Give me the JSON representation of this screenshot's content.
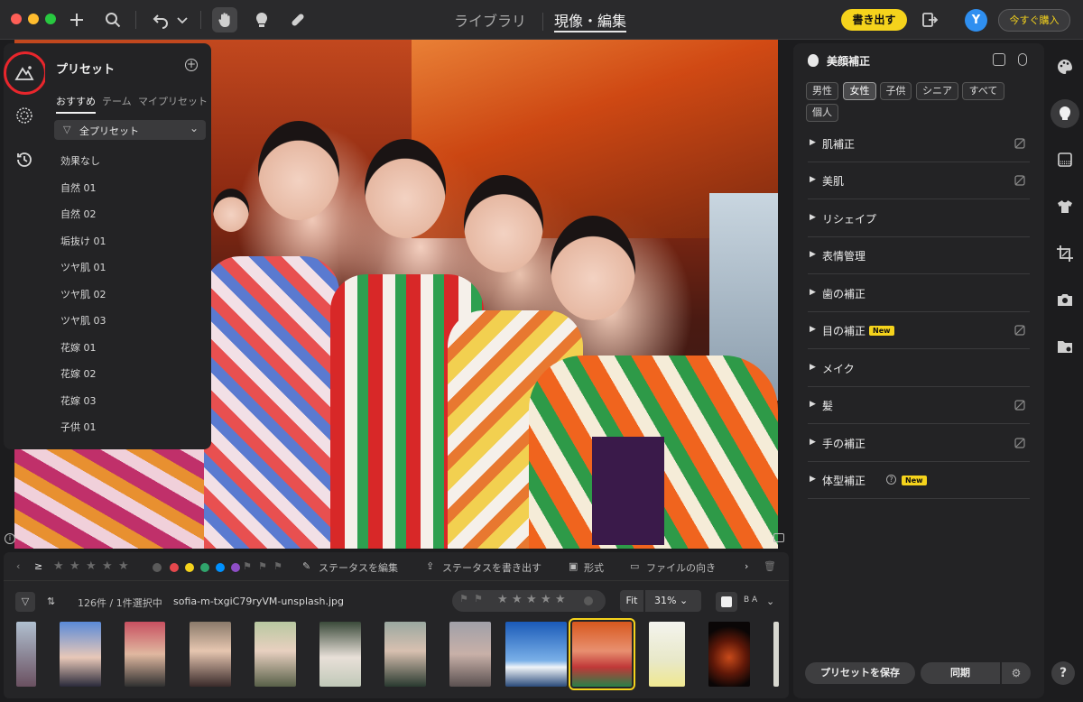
{
  "nav": {
    "library": "ライブラリ",
    "develop": "現像・編集"
  },
  "topbar": {
    "export_label": "書き出す",
    "avatar_initial": "Y",
    "buy_label": "今すぐ購入"
  },
  "presets": {
    "title": "プリセット",
    "add_glyph": "+",
    "tabs": [
      "おすすめ",
      "テーム",
      "マイプリセット"
    ],
    "filter_icon": "▽",
    "filter_label": "全プリセット",
    "filter_chevron": "⌄",
    "items": [
      "効果なし",
      "自然 01",
      "自然 02",
      "垢抜け 01",
      "ツヤ肌 01",
      "ツヤ肌 02",
      "ツヤ肌 03",
      "花嫁 01",
      "花嫁 02",
      "花嫁 03",
      "子供 01"
    ]
  },
  "image_info_glyph": "i",
  "filmstrip": {
    "status_edit": "ステータスを編集",
    "status_export": "ステータスを書き出す",
    "format": "形式",
    "orientation": "ファイルの向き",
    "count": "126件 / 1件選択中",
    "filename": "sofia-m-txgiC79ryVM-unsplash.jpg",
    "fit": "Fit",
    "zoom": "31%",
    "compare_label": "B A",
    "gte_glyph": "≥",
    "star_glyph": "★",
    "color_labels": [
      "#e5484d",
      "#f5d31c",
      "#30a46c",
      "#0091ff",
      "#8e4ec6"
    ]
  },
  "adjust": {
    "title": "美顔補正",
    "chips": [
      "男性",
      "女性",
      "子供",
      "シニア",
      "すべて",
      "個人"
    ],
    "active_chip": "女性",
    "sections": [
      "肌補正",
      "美肌",
      "リシェイプ",
      "表情管理",
      "歯の補正",
      "目の補正",
      "メイク",
      "髪",
      "手の補正",
      "体型補正"
    ],
    "new_badge": "New",
    "arrow_glyph": "▶",
    "q_glyph": "?",
    "save_preset": "プリセットを保存",
    "sync": "同期",
    "gear_glyph": "⚙"
  },
  "help_glyph": "?",
  "colors": {
    "accent": "#f5d31c",
    "highlight_ring": "#e8262c",
    "avatar": "#2f8ff0"
  }
}
